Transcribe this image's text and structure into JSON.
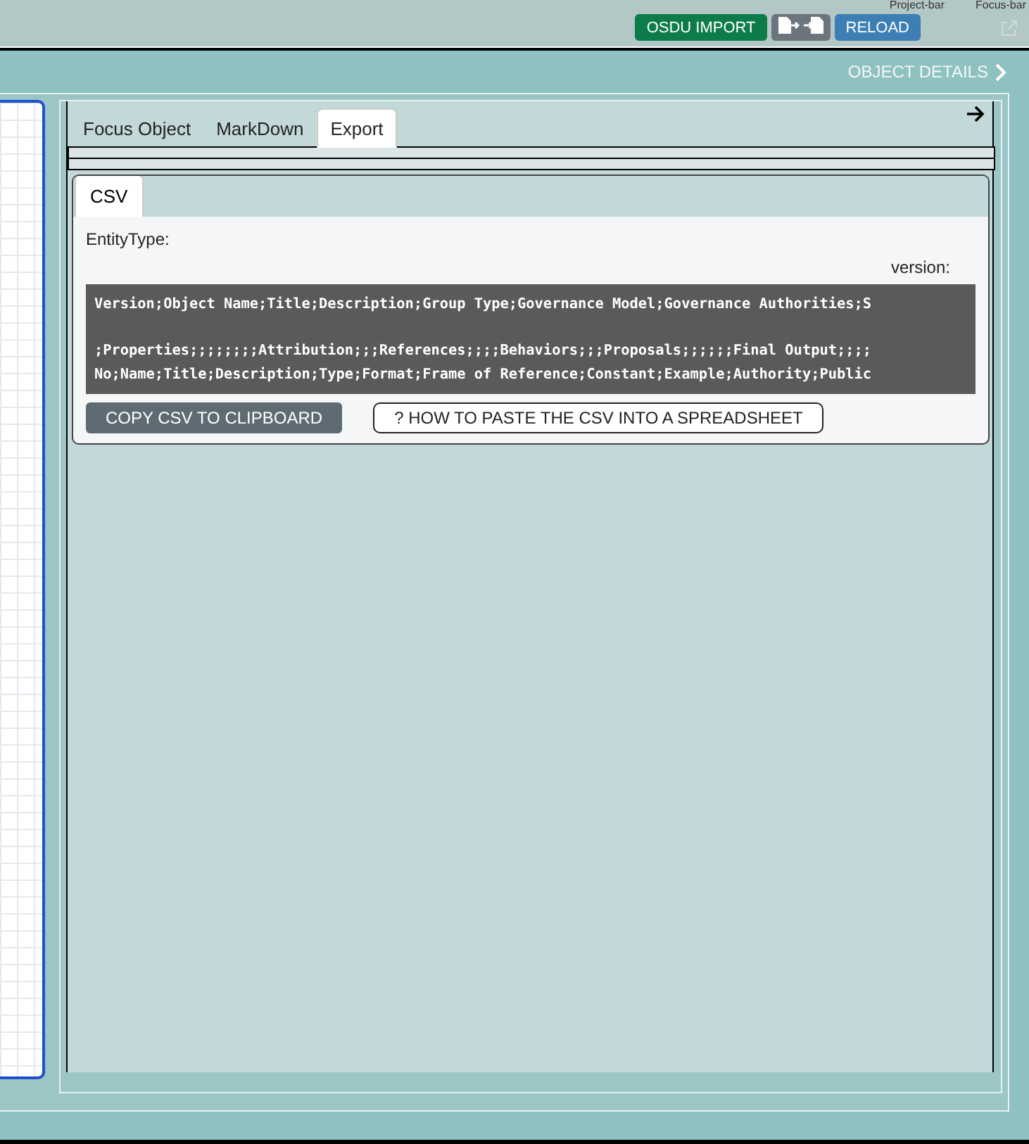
{
  "top_bar": {
    "toggles": [
      {
        "label": "Project-bar"
      },
      {
        "label": "Focus-bar"
      }
    ],
    "buttons": [
      {
        "kind": "import",
        "label": "OSDU IMPORT"
      },
      {
        "kind": "icon"
      },
      {
        "kind": "reload",
        "label": "RELOAD"
      }
    ]
  },
  "panel": {
    "title": "OBJECT DETAILS"
  },
  "tabs": [
    {
      "label": "Focus Object",
      "selected": false
    },
    {
      "label": "MarkDown",
      "selected": false
    },
    {
      "label": "Export",
      "selected": true
    }
  ],
  "subtabs": [
    {
      "label": "CSV",
      "selected": true
    }
  ],
  "entity_type_label": "EntityType:",
  "version_label": "version:",
  "csv_lines": [
    "Version;Object Name;Title;Description;Group Type;Governance Model;Governance Authorities;S",
    ";Properties;;;;;;;;Attribution;;;References;;;;Behaviors;;;Proposals;;;;;;Final Output;;;;",
    "No;Name;Title;Description;Type;Format;Frame of Reference;Constant;Example;Authority;Public"
  ],
  "actions": [
    {
      "kind": "copy",
      "label": "COPY CSV TO CLIPBOARD"
    },
    {
      "kind": "help",
      "label": "? HOW TO PASTE THE CSV INTO A SPREADSHEET"
    }
  ]
}
